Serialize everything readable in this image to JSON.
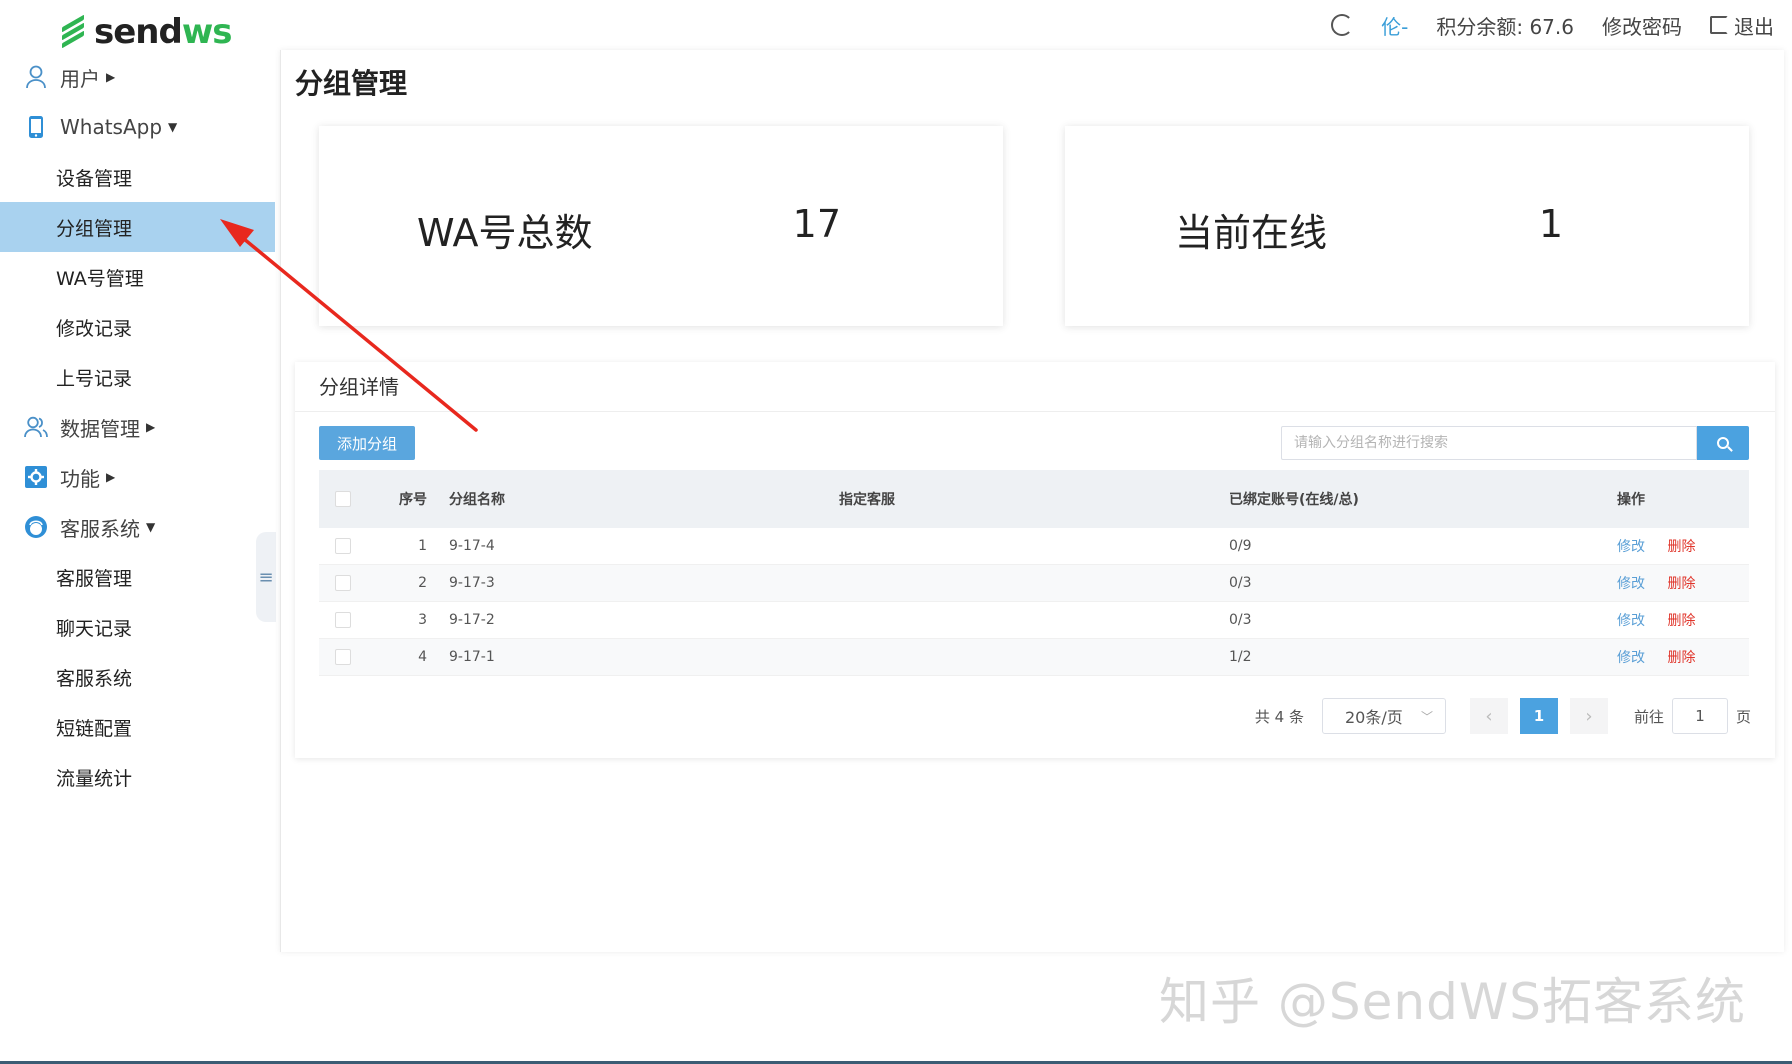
{
  "brand": {
    "name_part1": "send",
    "name_part2": "ws"
  },
  "topbar": {
    "user": "伦-",
    "balance": "积分余额: 67.6",
    "change_password": "修改密码",
    "logout": "退出"
  },
  "sidebar": {
    "groups": [
      {
        "label": "用户",
        "icon": "user-icon"
      },
      {
        "label": "WhatsApp",
        "icon": "phone-icon"
      },
      {
        "label": "数据管理",
        "icon": "users-icon"
      },
      {
        "label": "功能",
        "icon": "gear-icon"
      },
      {
        "label": "客服系统",
        "icon": "agent-icon"
      }
    ],
    "whatsapp_items": [
      "设备管理",
      "分组管理",
      "WA号管理",
      "修改记录",
      "上号记录"
    ],
    "service_items": [
      "客服管理",
      "聊天记录",
      "客服系统",
      "短链配置",
      "流量统计"
    ],
    "collapse_glyph": "≡"
  },
  "page": {
    "title": "分组管理"
  },
  "stats": {
    "total_label": "WA号总数",
    "total_value": "17",
    "online_label": "当前在线",
    "online_value": "1"
  },
  "detail": {
    "title": "分组详情",
    "add_button": "添加分组",
    "search_placeholder": "请输入分组名称进行搜索",
    "columns": [
      "序号",
      "分组名称",
      "指定客服",
      "已绑定账号(在线/总)",
      "操作"
    ],
    "rows": [
      {
        "index": "1",
        "name": "9-17-4",
        "service": "",
        "bound": "0/9"
      },
      {
        "index": "2",
        "name": "9-17-3",
        "service": "",
        "bound": "0/3"
      },
      {
        "index": "3",
        "name": "9-17-2",
        "service": "",
        "bound": "0/3"
      },
      {
        "index": "4",
        "name": "9-17-1",
        "service": "",
        "bound": "1/2"
      }
    ],
    "op_edit": "修改",
    "op_delete": "删除"
  },
  "pager": {
    "total": "共 4 条",
    "page_size": "20条/页",
    "current_page": "1",
    "goto_label": "前往",
    "goto_value": "1",
    "page_unit": "页"
  },
  "watermark": "知乎 @SendWS拓客系统",
  "colors": {
    "accent": "#4ba2e0",
    "brand_green": "#2fb552",
    "active_menu": "#a9d2ef",
    "delete_red": "#e0352b",
    "annotation_arrow": "#e8281e"
  }
}
